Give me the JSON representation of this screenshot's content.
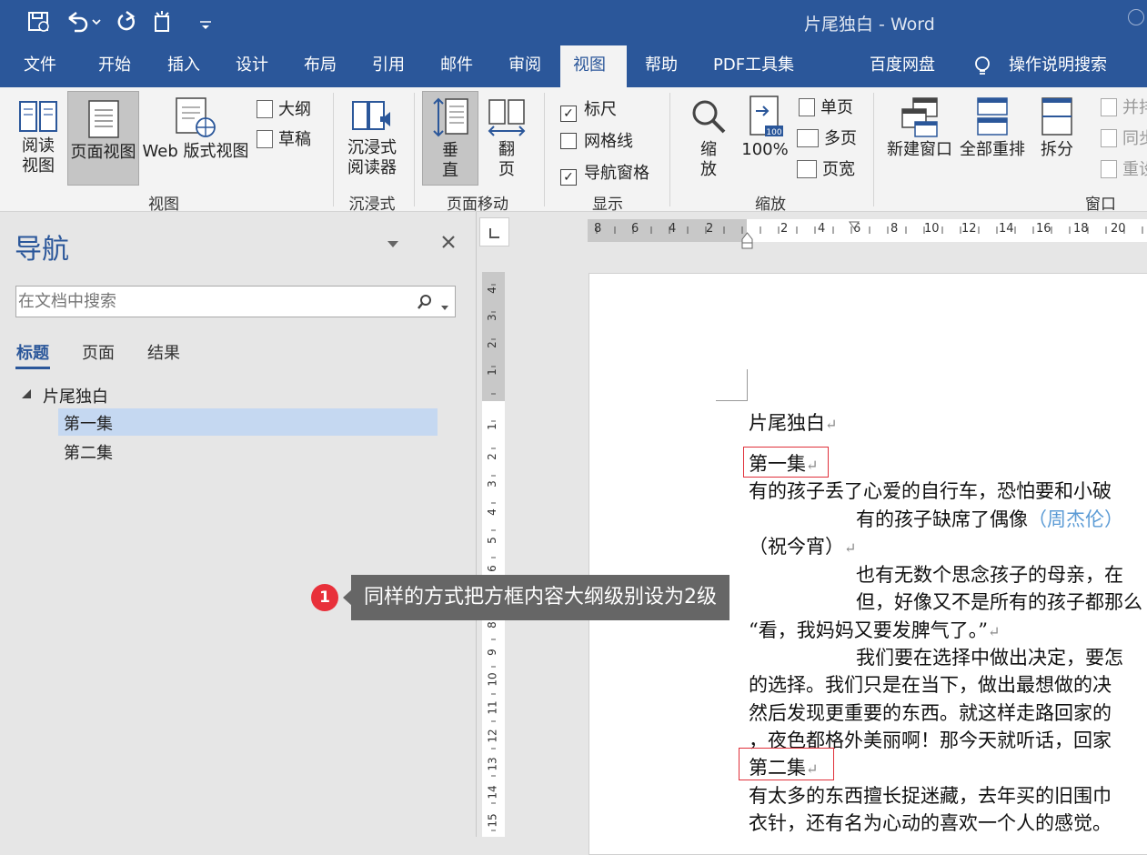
{
  "window": {
    "title": "片尾独白",
    "sep": " - ",
    "app": "Word"
  },
  "tabs": [
    "文件",
    "开始",
    "插入",
    "设计",
    "布局",
    "引用",
    "邮件",
    "审阅",
    "视图",
    "帮助",
    "PDF工具集",
    "百度网盘",
    "操作说明搜索"
  ],
  "ribbon": {
    "read_view": [
      "阅读",
      "视图"
    ],
    "page_view": "页面视图",
    "web_view": "Web 版式视图",
    "outline": "大纲",
    "draft": "草稿",
    "immersive_reader": [
      "沉浸式",
      "阅读器"
    ],
    "vertical": [
      "垂",
      "直"
    ],
    "flip": [
      "翻",
      "页"
    ],
    "ruler": "标尺",
    "gridlines": "网格线",
    "nav_pane": "导航窗格",
    "zoom": [
      "缩",
      "放"
    ],
    "zoom100": "100%",
    "zoom100_icon_text": "100",
    "one_page": "单页",
    "multi_page": "多页",
    "page_width": "页宽",
    "new_window": "新建窗口",
    "arrange_all": "全部重排",
    "split": "拆分",
    "side_by_side": "并排",
    "sync_scroll": "同步",
    "reset_pos": "重设",
    "groups": {
      "views": "视图",
      "immersive": "沉浸式",
      "page_move": "页面移动",
      "show": "显示",
      "zoom": "缩放",
      "window": "窗口"
    },
    "states": {
      "ruler": true,
      "gridlines": false,
      "nav_pane": true
    }
  },
  "navpane": {
    "title": "导航",
    "search_placeholder": "在文档中搜索",
    "tabs": [
      "标题",
      "页面",
      "结果"
    ],
    "tree": {
      "root": "片尾独白",
      "children": [
        "第一集",
        "第二集"
      ]
    }
  },
  "ruler": {
    "h_ticks": [
      "8",
      "6",
      "4",
      "2",
      "2",
      "4",
      "6",
      "8",
      "10",
      "12",
      "14",
      "16",
      "18",
      "20"
    ],
    "v_ticks": [
      "4",
      "3",
      "2",
      "1",
      "1",
      "2",
      "3",
      "4",
      "5",
      "6",
      "7",
      "8",
      "9",
      "10",
      "11",
      "12",
      "13",
      "14",
      "15"
    ]
  },
  "callout": {
    "num": "1",
    "text": "同样的方式把方框内容大纲级别设为2级"
  },
  "doc": {
    "title": "片尾独白",
    "h1": "第一集",
    "p1": "有的孩子丢了心爱的自行车，恐怕要和小破",
    "p2a": "有的孩子缺席了偶像",
    "p2link": "（周杰伦）",
    "p3": "（祝今宵）",
    "p4": "也有无数个思念孩子的母亲，在",
    "p5": "但，好像又不是所有的孩子都那么",
    "p6": "“看，我妈妈又要发脾气了。”",
    "p7": "我们要在选择中做出决定，要怎",
    "p8": "的选择。我们只是在当下，做出最想做的决",
    "p9": "然后发现更重要的东西。就这样走路回家的",
    "p10": "，夜色都格外美丽啊！那今天就听话，回家",
    "h2": "第二集",
    "p11": "有太多的东西擅长捉迷藏，去年买的旧围巾",
    "p12": "衣针，还有名为心动的喜欢一个人的感觉。"
  }
}
